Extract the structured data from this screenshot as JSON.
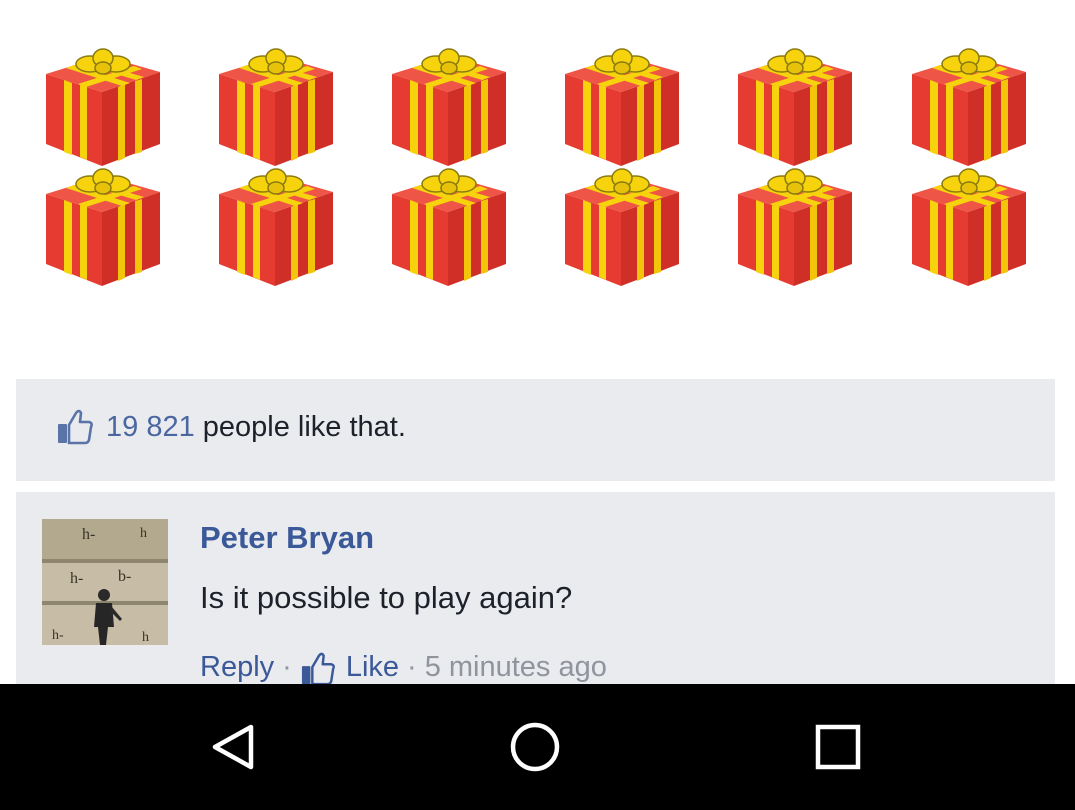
{
  "gifts": {
    "icon": "gift-box-icon",
    "colors": {
      "box": "#e63b30",
      "ribbon": "#f6d30c",
      "shade": "#c62a22"
    }
  },
  "likes": {
    "icon": "thumbs-up-icon",
    "count": "19 821",
    "suffix": "people like that."
  },
  "comment": {
    "author": "Peter Bryan",
    "text": "Is it possible to play again?",
    "reply_label": "Reply",
    "like_label": "Like",
    "separator": "·",
    "timestamp": "5 minutes ago",
    "avatar_icon": "profile-photo"
  },
  "navbar": {
    "back_icon": "back-triangle-icon",
    "home_icon": "home-circle-icon",
    "recents_icon": "recents-square-icon"
  },
  "colors": {
    "link": "#3b5998",
    "panel_bg": "#e9ebee",
    "navbar_bg": "#000000"
  }
}
